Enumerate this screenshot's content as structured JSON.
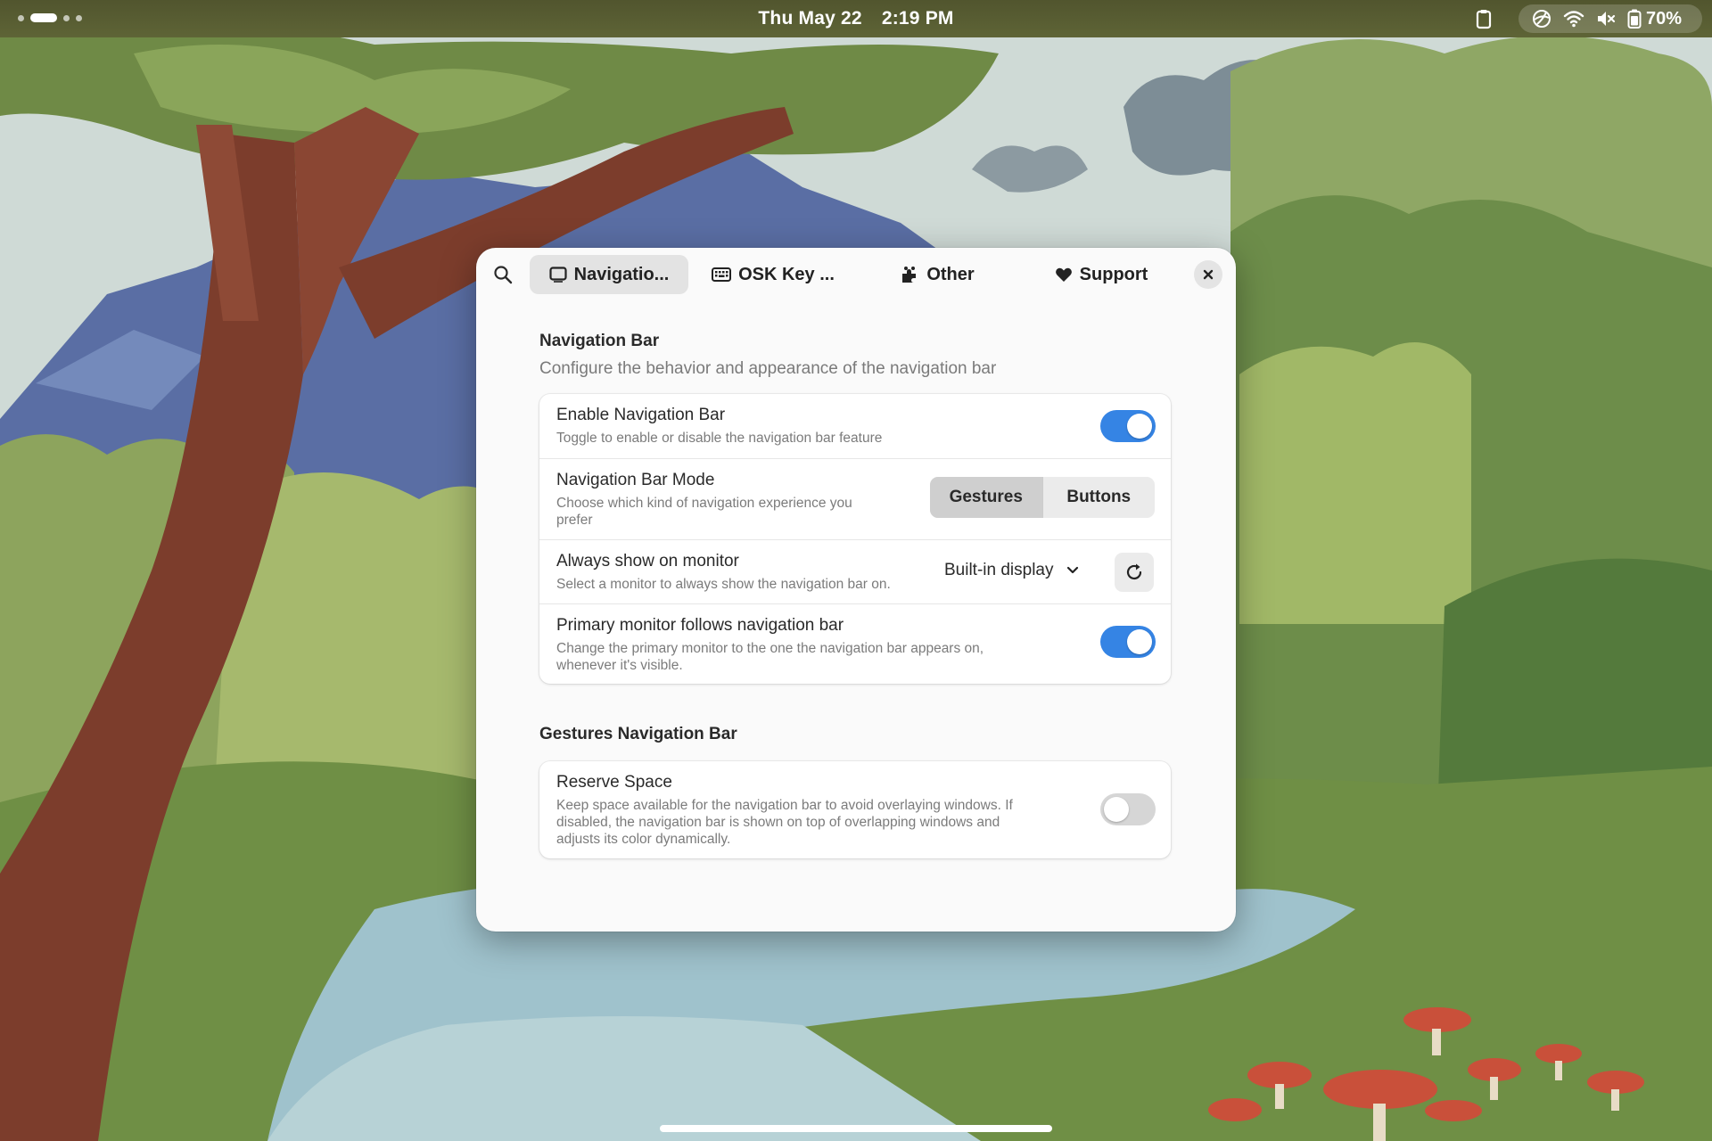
{
  "topbar": {
    "date": "Thu May 22",
    "time": "2:19 PM",
    "battery_percent": "70%",
    "workspace_count": 4,
    "active_workspace": 1,
    "tray_icons": [
      "clipboard-icon",
      "tailscale-icon",
      "wifi-icon",
      "speaker-muted-icon",
      "battery-icon"
    ]
  },
  "dialog": {
    "tabs": [
      {
        "label": "Navigatio...",
        "icon": "monitor-icon",
        "active": true
      },
      {
        "label": "OSK Key ...",
        "icon": "keyboard-icon",
        "active": false
      },
      {
        "label": "Other",
        "icon": "puzzle-icon",
        "active": false
      },
      {
        "label": "Support",
        "icon": "heart-icon",
        "active": false
      }
    ],
    "sections": {
      "navigation_bar": {
        "title": "Navigation Bar",
        "description": "Configure the behavior and appearance of the navigation bar",
        "rows": {
          "enable": {
            "title": "Enable Navigation Bar",
            "subtitle": "Toggle to enable or disable the navigation bar feature",
            "enabled": true
          },
          "mode": {
            "title": "Navigation Bar Mode",
            "subtitle_line1": "Choose which kind of navigation experience you",
            "subtitle_line2": "prefer",
            "options": [
              "Gestures",
              "Buttons"
            ],
            "selected": "Gestures"
          },
          "monitor": {
            "title": "Always show on monitor",
            "subtitle": "Select a monitor to always show the navigation bar on.",
            "value": "Built-in display"
          },
          "primary": {
            "title": "Primary monitor follows navigation bar",
            "subtitle_line1": "Change the primary monitor to the one the navigation bar appears on,",
            "subtitle_line2": "whenever it's visible.",
            "enabled": true
          }
        }
      },
      "gestures_navigation_bar": {
        "title": "Gestures Navigation Bar",
        "rows": {
          "reserve_space": {
            "title": "Reserve Space",
            "subtitle_line1": "Keep space available for the navigation bar to avoid overlaying windows. If",
            "subtitle_line2": "disabled, the navigation bar is shown on top of overlapping windows and",
            "subtitle_line3": "adjusts its color dynamically.",
            "enabled": false
          }
        }
      }
    }
  },
  "colors": {
    "accent": "#3584e4",
    "topbar": "#555a31",
    "dialog_bg": "#fafafa"
  }
}
